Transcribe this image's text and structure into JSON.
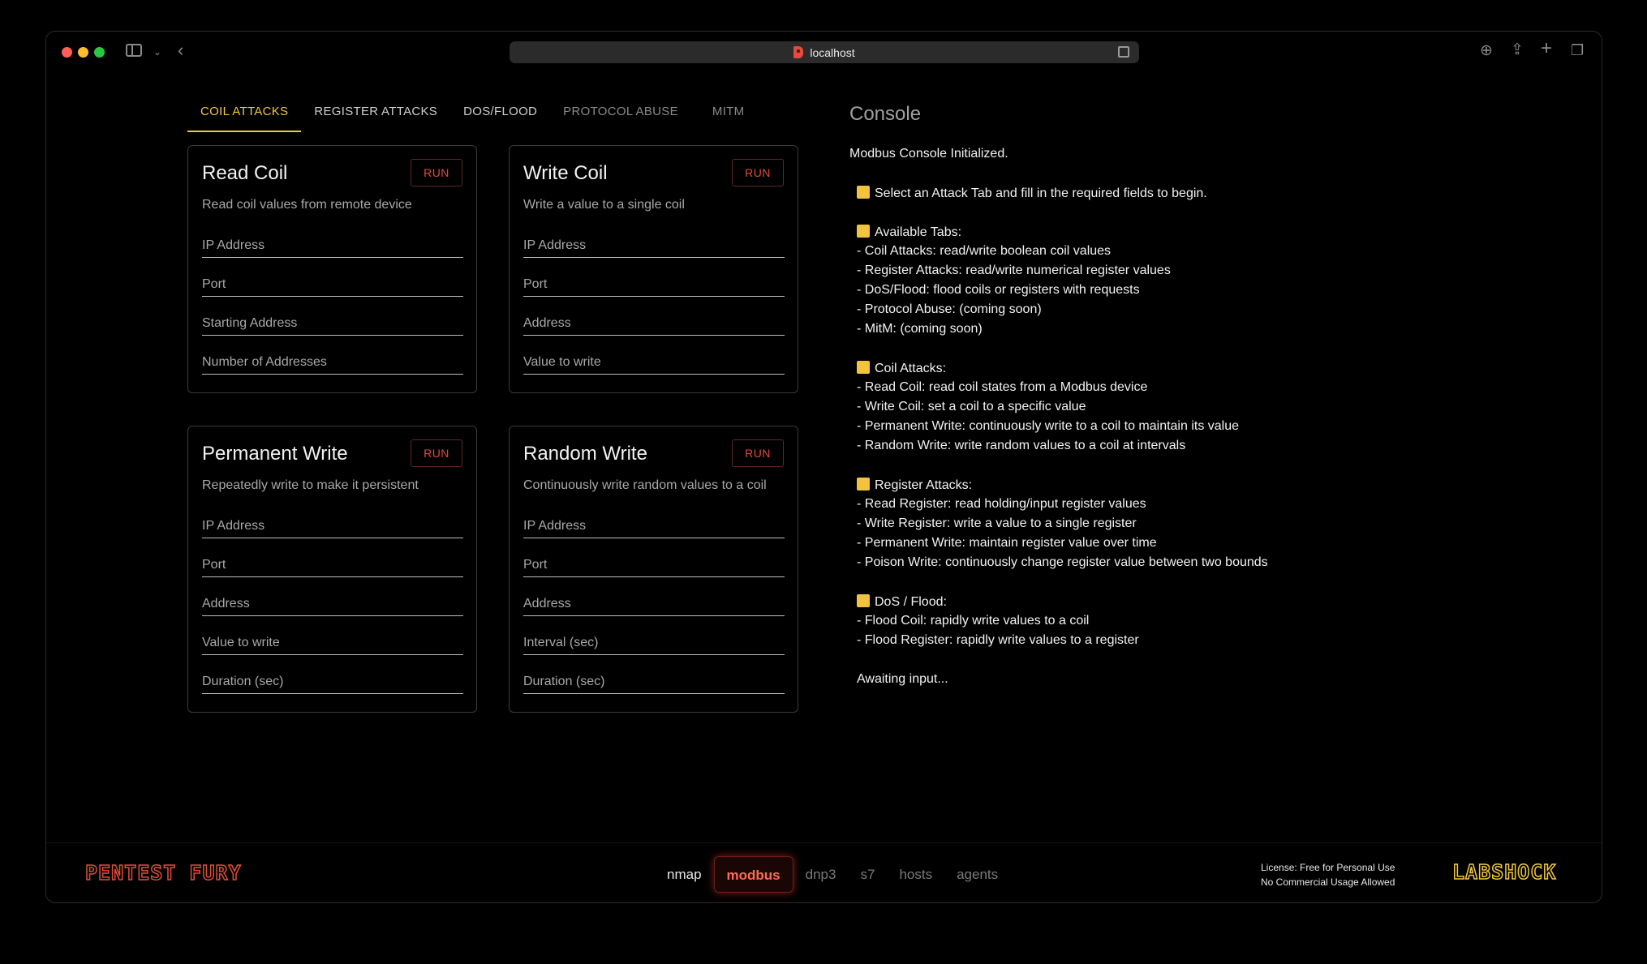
{
  "browser": {
    "url": "localhost"
  },
  "tabs": [
    {
      "label": "COIL ATTACKS"
    },
    {
      "label": "REGISTER ATTACKS"
    },
    {
      "label": "DOS/FLOOD"
    },
    {
      "label": "PROTOCOL ABUSE"
    },
    {
      "label": "MITM"
    }
  ],
  "cards": [
    {
      "title": "Read Coil",
      "run": "RUN",
      "description": "Read coil values from remote device",
      "fields": [
        "IP Address",
        "Port",
        "Starting Address",
        "Number of Addresses"
      ]
    },
    {
      "title": "Write Coil",
      "run": "RUN",
      "description": "Write a value to a single coil",
      "fields": [
        "IP Address",
        "Port",
        "Address",
        "Value to write"
      ]
    },
    {
      "title": "Permanent Write",
      "run": "RUN",
      "description": "Repeatedly write to make it persistent",
      "fields": [
        "IP Address",
        "Port",
        "Address",
        "Value to write",
        "Duration (sec)"
      ]
    },
    {
      "title": "Random Write",
      "run": "RUN",
      "description": "Continuously write random values to a coil",
      "fields": [
        "IP Address",
        "Port",
        "Address",
        "Interval (sec)",
        "Duration (sec)"
      ]
    }
  ],
  "console": {
    "title": "Console",
    "lines": [
      "Modbus Console Initialized.",
      "Select an Attack Tab and fill in the required fields to begin.",
      "Available Tabs:",
      "- Coil Attacks: read/write boolean coil values",
      "- Register Attacks: read/write numerical register values",
      "- DoS/Flood: flood coils or registers with requests",
      "- Protocol Abuse: (coming soon)",
      "- MitM: (coming soon)",
      "Coil Attacks:",
      "- Read Coil: read coil states from a Modbus device",
      "- Write Coil: set a coil to a specific value",
      "- Permanent Write: continuously write to a coil to maintain its value",
      "- Random Write: write random values to a coil at intervals",
      "Register Attacks:",
      "- Read Register: read holding/input register values",
      "- Write Register: write a value to a single register",
      "- Permanent Write: maintain register value over time",
      "- Poison Write: continuously change register value between two bounds",
      "DoS / Flood:",
      "- Flood Coil: rapidly write values to a coil",
      "- Flood Register: rapidly write values to a register",
      "Awaiting input..."
    ]
  },
  "footer": {
    "brand_left": "PENTEST FURY",
    "nav": [
      "nmap",
      "modbus",
      "dnp3",
      "s7",
      "hosts",
      "agents"
    ],
    "license_line1": "License: Free for Personal Use",
    "license_line2": "No Commercial Usage Allowed",
    "brand_right": "LABSHOCK"
  }
}
